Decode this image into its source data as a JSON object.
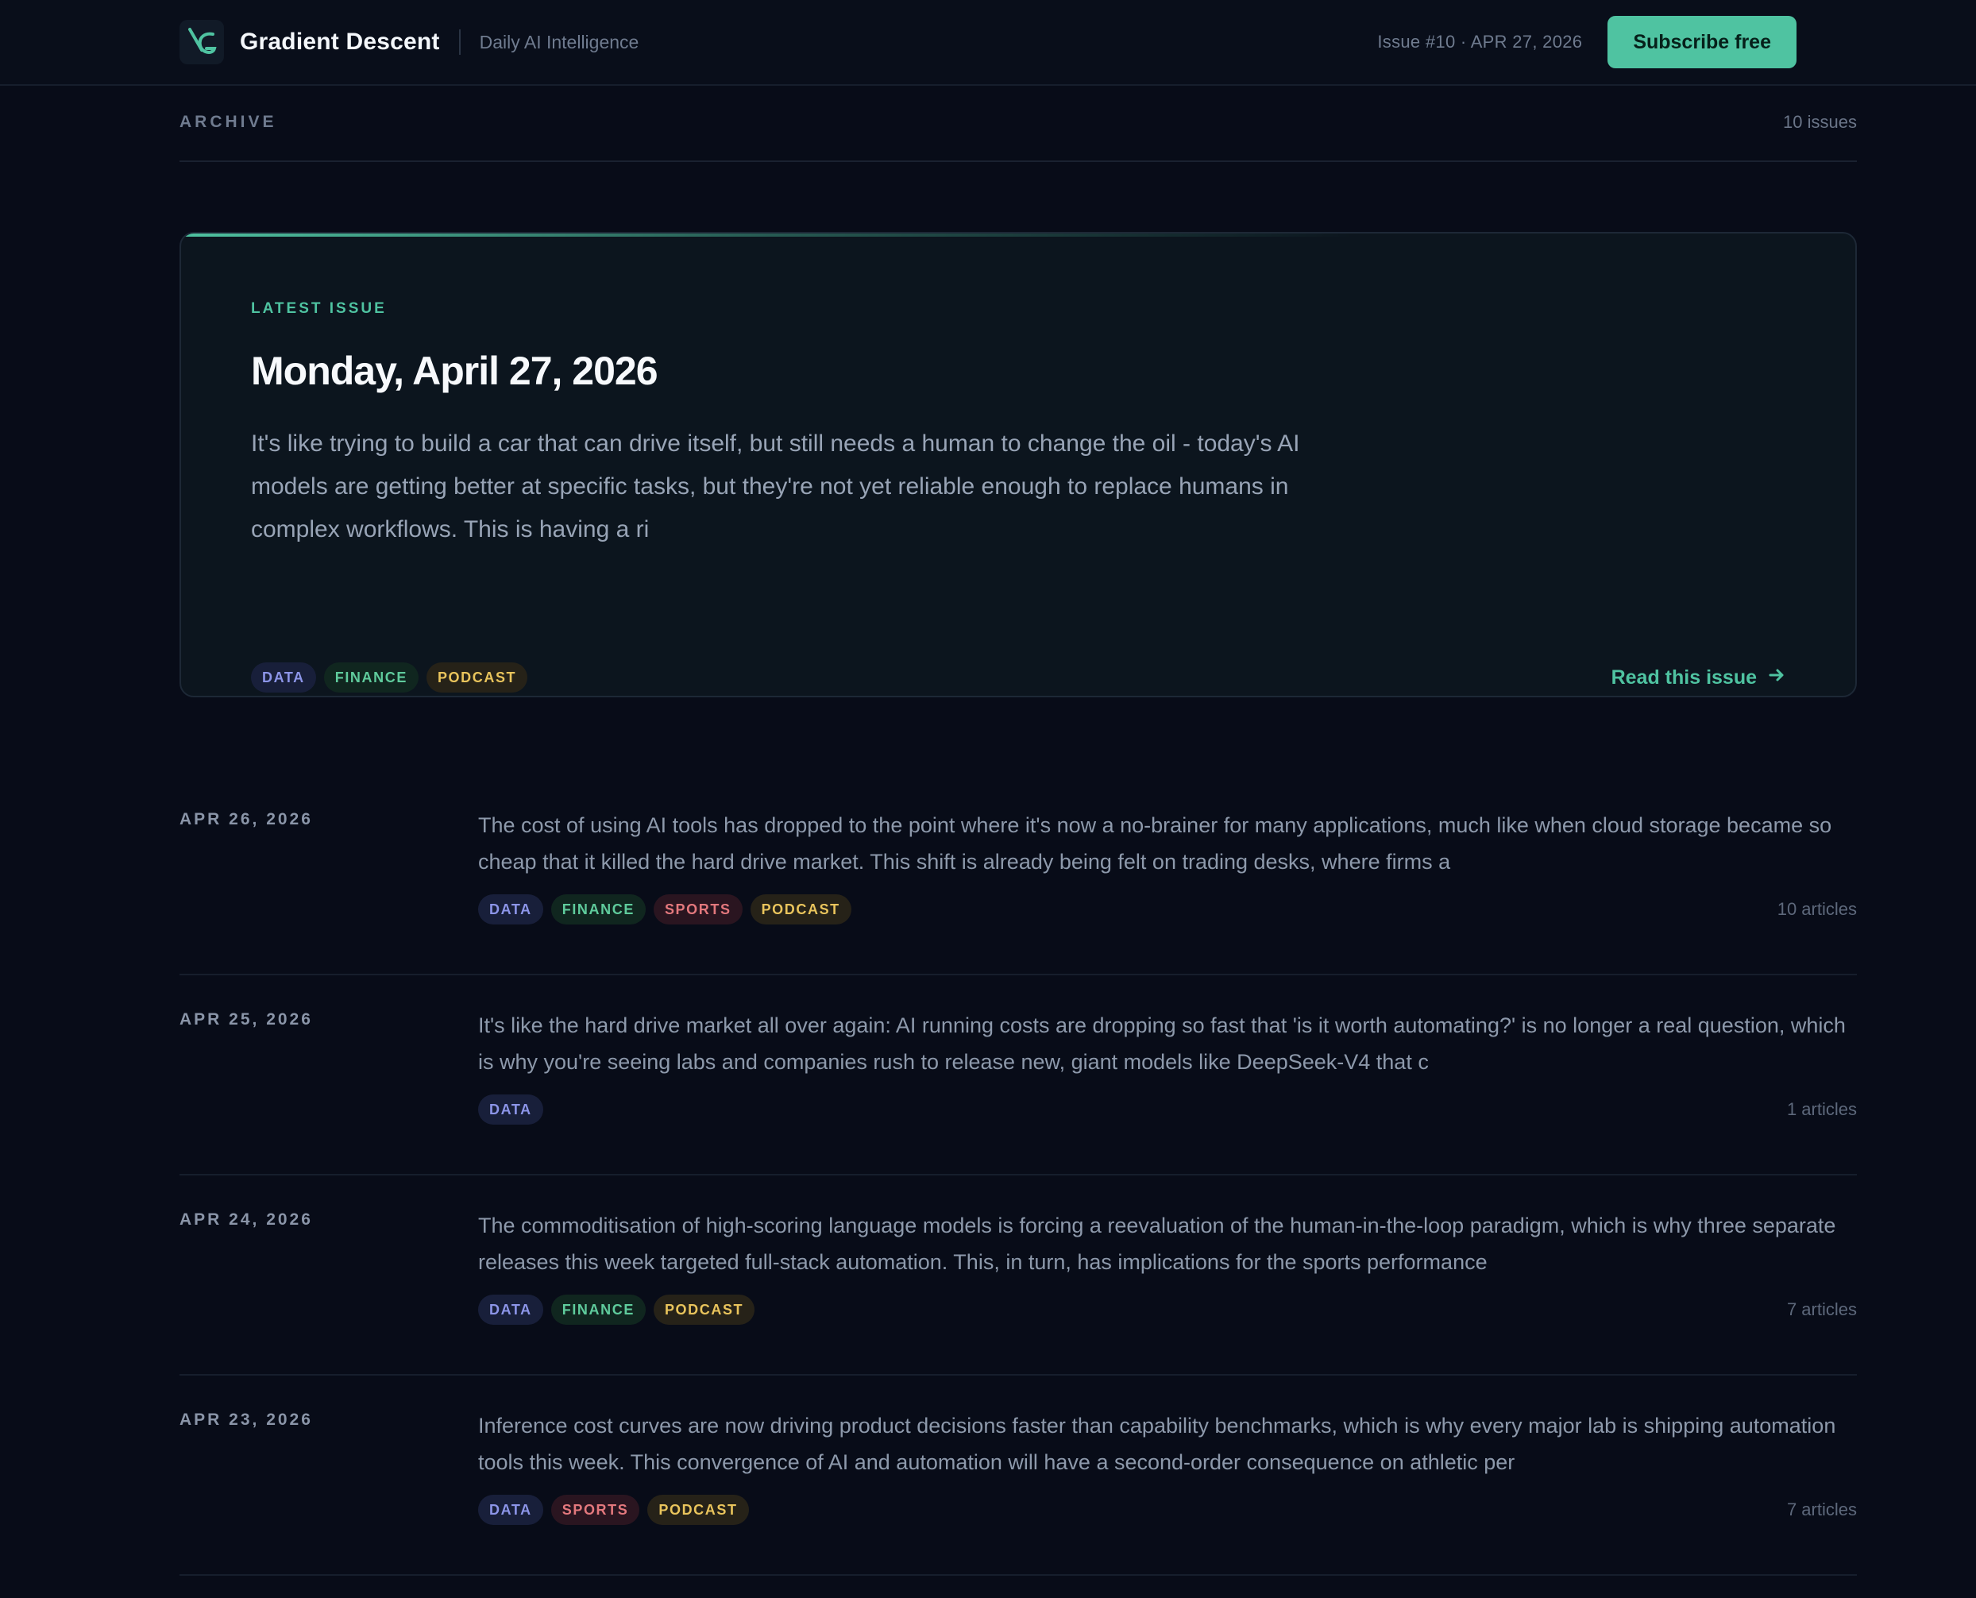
{
  "header": {
    "brand": "Gradient Descent",
    "tagline": "Daily AI Intelligence",
    "issue_meta": "Issue #10 · APR 27, 2026",
    "subscribe_label": "Subscribe free",
    "logo_icon": "gradient-descent-logo-icon"
  },
  "archive": {
    "label": "ARCHIVE",
    "count": "10 issues"
  },
  "featured": {
    "label": "LATEST ISSUE",
    "title": "Monday, April 27, 2026",
    "summary": "It's like trying to build a car that can drive itself, but still needs a human to change the oil - today's AI models are getting better at specific tasks, but they're not yet reliable enough to replace humans in complex workflows. This is having a ri",
    "tags": [
      "DATA",
      "FINANCE",
      "PODCAST"
    ],
    "read_label": "Read this issue",
    "read_icon": "arrow-right-icon"
  },
  "issues": [
    {
      "date": "APR 26, 2026",
      "summary": "The cost of using AI tools has dropped to the point where it's now a no-brainer for many applications, much like when cloud storage became so cheap that it killed the hard drive market. This shift is already being felt on trading desks, where firms a",
      "tags": [
        "DATA",
        "FINANCE",
        "SPORTS",
        "PODCAST"
      ],
      "count": "10 articles"
    },
    {
      "date": "APR 25, 2026",
      "summary": "It's like the hard drive market all over again: AI running costs are dropping so fast that 'is it worth automating?' is no longer a real question, which is why you're seeing labs and companies rush to release new, giant models like DeepSeek-V4 that c",
      "tags": [
        "DATA"
      ],
      "count": "1 articles"
    },
    {
      "date": "APR 24, 2026",
      "summary": "The commoditisation of high-scoring language models is forcing a reevaluation of the human-in-the-loop paradigm, which is why three separate releases this week targeted full-stack automation. This, in turn, has implications for the sports performance",
      "tags": [
        "DATA",
        "FINANCE",
        "PODCAST"
      ],
      "count": "7 articles"
    },
    {
      "date": "APR 23, 2026",
      "summary": "Inference cost curves are now driving product decisions faster than capability benchmarks, which is why every major lab is shipping automation tools this week. This convergence of AI and automation will have a second-order consequence on athletic per",
      "tags": [
        "DATA",
        "SPORTS",
        "PODCAST"
      ],
      "count": "7 articles"
    }
  ],
  "colors": {
    "accent": "#4fc3a1",
    "background": "#080c18",
    "tag_data": "#8c95e8",
    "tag_finance": "#5fcb9c",
    "tag_sports": "#e3787d",
    "tag_podcast": "#e9c45c"
  }
}
